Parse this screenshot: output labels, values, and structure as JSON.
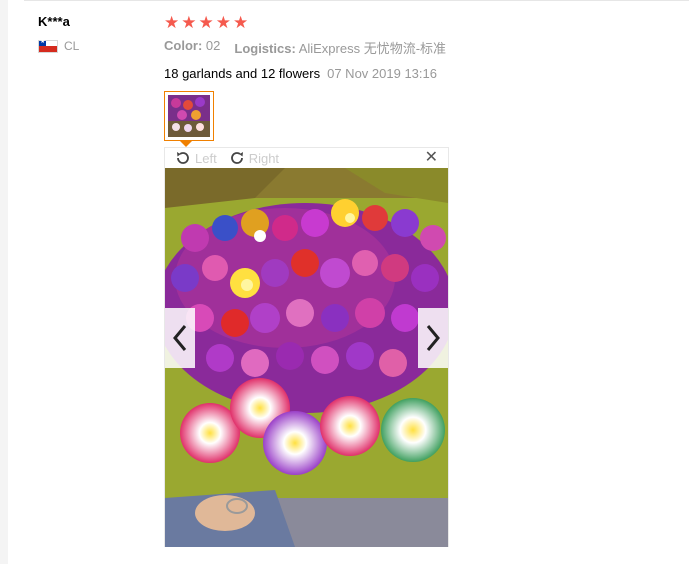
{
  "reviewer": {
    "name": "K***a",
    "country_code": "CL",
    "flag_icon": "chile-flag-icon"
  },
  "review": {
    "rating": 5,
    "max_rating": 5,
    "star_color": "#f55a4e",
    "color_label": "Color:",
    "color_value": "02",
    "logistics_label": "Logistics:",
    "logistics_value": "AliExpress 无忧物流-标准",
    "text": "18 garlands and 12 flowers",
    "date": "07 Nov 2019 13:16"
  },
  "viewer": {
    "rotate_left_label": "Left",
    "rotate_right_label": "Right",
    "close_icon": "close-icon",
    "prev_icon": "chevron-left-icon",
    "next_icon": "chevron-right-icon",
    "thumb_border_color": "#f08000"
  }
}
